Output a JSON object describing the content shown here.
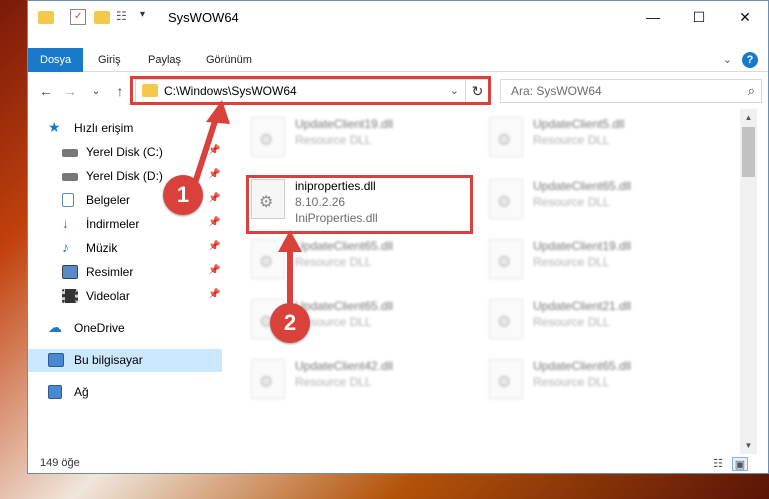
{
  "window": {
    "title": "SysWOW64",
    "controls": {
      "minimize": "—",
      "maximize": "☐",
      "close": "✕"
    }
  },
  "ribbon": {
    "tabs": [
      "Dosya",
      "Giriş",
      "Paylaş",
      "Görünüm"
    ],
    "active_tab": "Dosya",
    "help": "?"
  },
  "navigation": {
    "back": "←",
    "forward": "→",
    "recent": "⌄",
    "up": "↑",
    "address": "C:\\Windows\\SysWOW64",
    "refresh": "↻",
    "search_placeholder": "Ara: SysWOW64"
  },
  "sidebar": {
    "items": [
      {
        "label": "Hızlı erişim",
        "icon": "star-icon",
        "pinned": false
      },
      {
        "label": "Yerel Disk (C:)",
        "icon": "drive-icon",
        "pinned": true
      },
      {
        "label": "Yerel Disk (D:)",
        "icon": "drive-icon",
        "pinned": true
      },
      {
        "label": "Belgeler",
        "icon": "documents-icon",
        "pinned": true
      },
      {
        "label": "İndirmeler",
        "icon": "download-icon",
        "pinned": true
      },
      {
        "label": "Müzik",
        "icon": "music-icon",
        "pinned": true
      },
      {
        "label": "Resimler",
        "icon": "pictures-icon",
        "pinned": true
      },
      {
        "label": "Videolar",
        "icon": "videos-icon",
        "pinned": true
      },
      {
        "label": "OneDrive",
        "icon": "cloud-icon",
        "pinned": false
      },
      {
        "label": "Bu bilgisayar",
        "icon": "computer-icon",
        "pinned": false,
        "selected": true
      },
      {
        "label": "Ağ",
        "icon": "network-icon",
        "pinned": false
      }
    ]
  },
  "files": [
    {
      "name": "UpdateClient19.dll",
      "type": "Resource DLL",
      "blurred": true
    },
    {
      "name": "UpdateClient5.dll",
      "type": "Resource DLL",
      "blurred": true
    },
    {
      "name": "iniproperties.dll",
      "version": "8.10.2.26",
      "type": "IniProperties.dll",
      "blurred": false,
      "highlighted": true
    },
    {
      "name": "UpdateClient65.dll",
      "type": "Resource DLL",
      "blurred": true
    },
    {
      "name": "UpdateClient65.dll",
      "type": "Resource DLL",
      "blurred": true
    },
    {
      "name": "UpdateClient19.dll",
      "type": "Resource DLL",
      "blurred": true
    },
    {
      "name": "UpdateClient65.dll",
      "type": "Resource DLL",
      "blurred": true
    },
    {
      "name": "UpdateClient21.dll",
      "type": "Resource DLL",
      "blurred": true
    },
    {
      "name": "UpdateClient42.dll",
      "type": "Resource DLL",
      "blurred": true
    },
    {
      "name": "UpdateClient65.dll",
      "type": "Resource DLL",
      "blurred": true
    }
  ],
  "status": {
    "count": "149 öğe"
  },
  "annotations": {
    "marker1": "1",
    "marker2": "2",
    "color": "#d9413a"
  }
}
